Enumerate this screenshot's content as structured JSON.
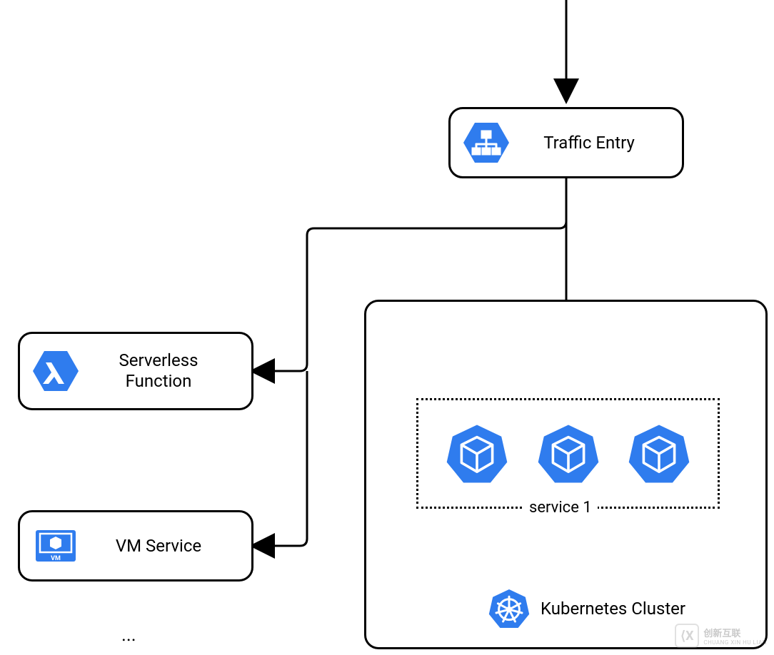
{
  "nodes": {
    "traffic_entry": {
      "label": "Traffic Entry"
    },
    "serverless": {
      "label": "Serverless\nFunction"
    },
    "vm_service": {
      "label": "VM Service"
    }
  },
  "cluster": {
    "label": "Kubernetes Cluster",
    "service_label": "service 1",
    "pod_count": 3
  },
  "misc": {
    "ellipsis": "...",
    "watermark_text": "创新互联",
    "watermark_sub": "CHUANG XIN HU LIAN"
  },
  "colors": {
    "brand_blue": "#2F7CEE",
    "white": "#FFFFFF"
  }
}
